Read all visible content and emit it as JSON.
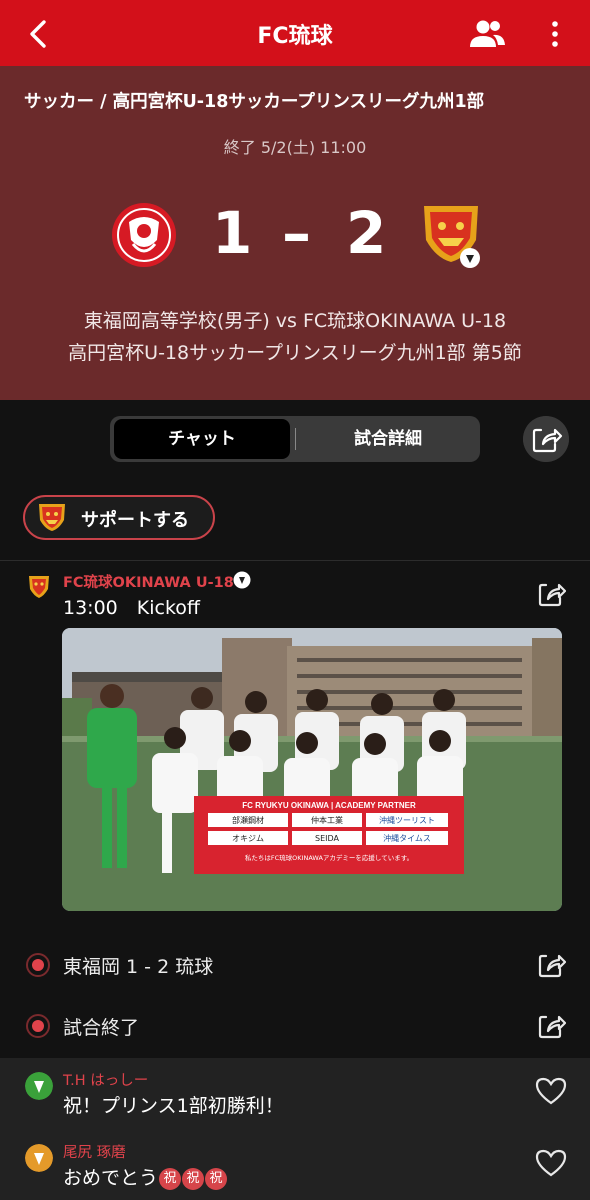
{
  "header": {
    "title": "FC琉球"
  },
  "match": {
    "breadcrumb": "サッカー / 高円宮杯U-18サッカープリンスリーグ九州1部",
    "status": "終了 5/2(土) 11:00",
    "home_score": "1",
    "away_score": "2",
    "separator": "–",
    "teams": "東福岡高等学校(男子) vs FC琉球OKINAWA U-18",
    "round": "高円宮杯U-18サッカープリンスリーグ九州1部 第5節"
  },
  "tabs": [
    {
      "label": "チャット",
      "active": true
    },
    {
      "label": "試合詳細",
      "active": false
    }
  ],
  "support": {
    "label": "サポートする"
  },
  "post": {
    "author": "FC琉球OKINAWA U-18",
    "text": "13:00　Kickoff",
    "photo": {
      "banner_title": "FC RYUKYU OKINAWA | ACADEMY PARTNER",
      "sponsors": [
        "部瀬鋼材",
        "仲本工業",
        "沖縄ツーリスト",
        "オキジム",
        "SEIDA",
        "沖縄タイムス"
      ],
      "caption": "私たちはFC琉球OKINAWAアカデミーを応援しています。"
    }
  },
  "events": [
    {
      "text": "東福岡 1 - 2 琉球"
    },
    {
      "text": "試合終了"
    }
  ],
  "comments": [
    {
      "name": "T.H はっしー",
      "text": "祝！プリンス1部初勝利！",
      "avatar_color": "#3aa13a"
    },
    {
      "name": "尾尻 琢磨",
      "text": "おめでとう",
      "avatar_color": "#e49a2a",
      "emoji": [
        "祝",
        "祝",
        "祝"
      ]
    }
  ],
  "colors": {
    "brand": "#d3101a",
    "header_bg": "#6b2a2b",
    "accent": "#e0434b"
  },
  "icons": [
    "back-arrow-icon",
    "people-icon",
    "more-vertical-icon",
    "share-icon",
    "live-dot-icon",
    "heart-icon"
  ]
}
